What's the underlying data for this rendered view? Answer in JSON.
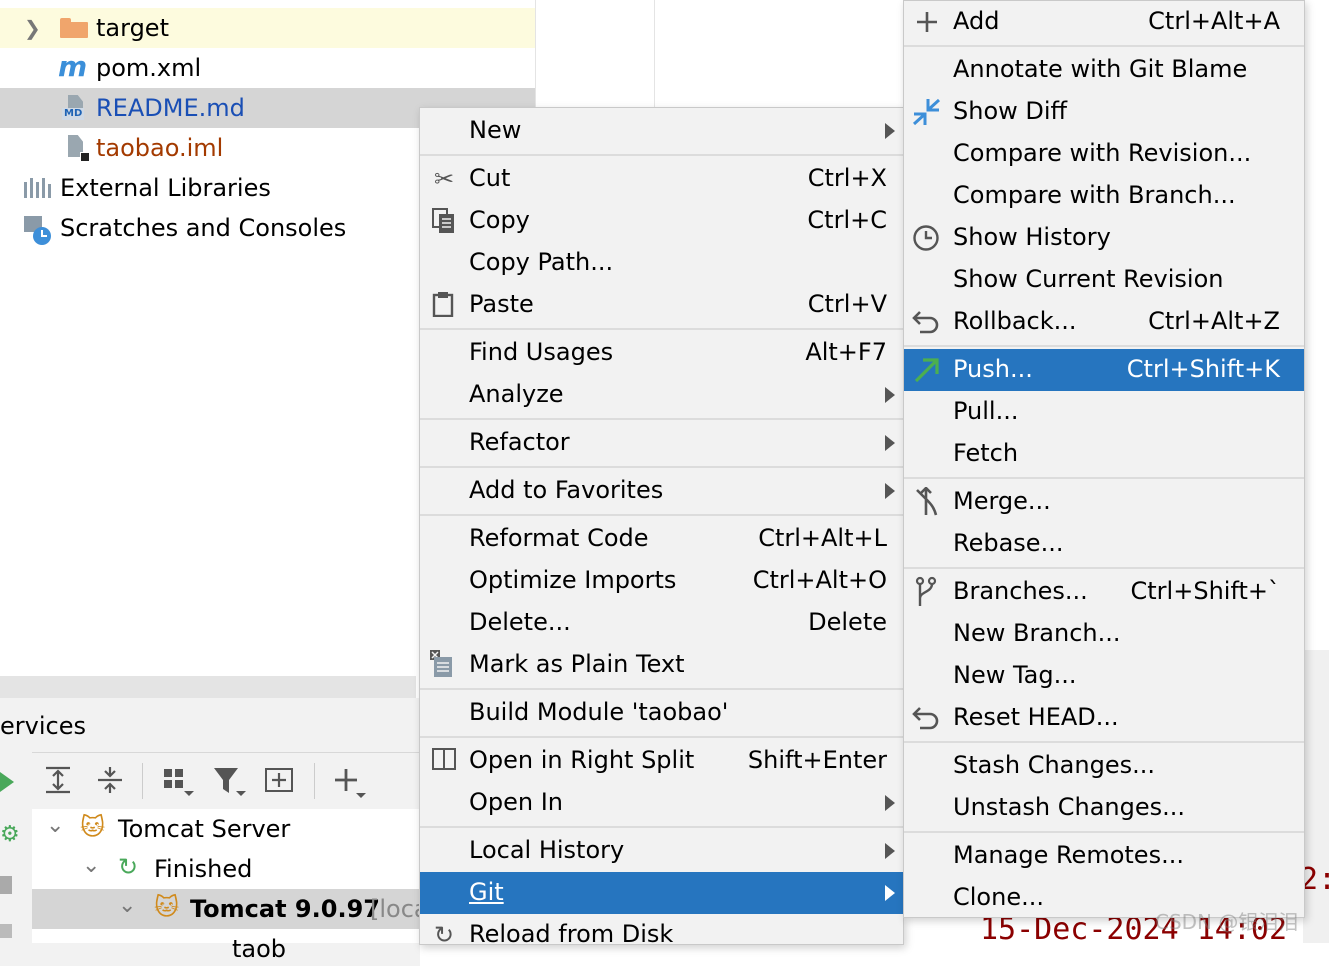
{
  "project_tree": {
    "items": [
      {
        "label": "target",
        "icon": "folder-icon",
        "color": "#000000"
      },
      {
        "label": "pom.xml",
        "icon": "maven-icon",
        "color": "#000000"
      },
      {
        "label": "README.md",
        "icon": "markdown-file-icon",
        "icon_tag": "MD",
        "color": "#1a4fb5"
      },
      {
        "label": "taobao.iml",
        "icon": "module-file-icon",
        "color": "#a33a00"
      },
      {
        "label": "External Libraries",
        "icon": "library-icon",
        "color": "#000000"
      },
      {
        "label": "Scratches and Consoles",
        "icon": "scratches-icon",
        "color": "#000000"
      }
    ]
  },
  "services": {
    "title": "ervices",
    "tree": [
      {
        "label": "Tomcat Server"
      },
      {
        "label": "Finished"
      },
      {
        "label": "Tomcat 9.0.97",
        "suffix": "[loca"
      },
      {
        "label": "taob"
      }
    ]
  },
  "context_menu": {
    "items": [
      {
        "label": "New",
        "shortcut": "",
        "submenu": true
      },
      {
        "label": "Cut",
        "shortcut": "Ctrl+X",
        "icon": "scissors-icon"
      },
      {
        "label": "Copy",
        "shortcut": "Ctrl+C",
        "icon": "copy-icon"
      },
      {
        "label": "Copy Path...",
        "shortcut": ""
      },
      {
        "label": "Paste",
        "shortcut": "Ctrl+V",
        "icon": "clipboard-icon"
      },
      {
        "label": "Find Usages",
        "shortcut": "Alt+F7"
      },
      {
        "label": "Analyze",
        "shortcut": "",
        "submenu": true
      },
      {
        "label": "Refactor",
        "shortcut": "",
        "submenu": true
      },
      {
        "label": "Add to Favorites",
        "shortcut": "",
        "submenu": true
      },
      {
        "label": "Reformat Code",
        "shortcut": "Ctrl+Alt+L"
      },
      {
        "label": "Optimize Imports",
        "shortcut": "Ctrl+Alt+O"
      },
      {
        "label": "Delete...",
        "shortcut": "Delete"
      },
      {
        "label": "Mark as Plain Text",
        "shortcut": "",
        "icon": "plain-text-icon"
      },
      {
        "label": "Build Module 'taobao'",
        "shortcut": ""
      },
      {
        "label": "Open in Right Split",
        "shortcut": "Shift+Enter",
        "icon": "split-icon"
      },
      {
        "label": "Open In",
        "shortcut": "",
        "submenu": true
      },
      {
        "label": "Local History",
        "shortcut": "",
        "submenu": true
      },
      {
        "label": "Git",
        "shortcut": "",
        "submenu": true,
        "selected": true
      },
      {
        "label": "Reload from Disk",
        "shortcut": "",
        "icon": "reload-icon"
      }
    ]
  },
  "git_menu": {
    "items": [
      {
        "label": "Add",
        "shortcut": "Ctrl+Alt+A",
        "icon": "plus-icon"
      },
      {
        "label": "Annotate with Git Blame",
        "shortcut": ""
      },
      {
        "label": "Show Diff",
        "shortcut": "",
        "icon": "diff-icon"
      },
      {
        "label": "Compare with Revision...",
        "shortcut": ""
      },
      {
        "label": "Compare with Branch...",
        "shortcut": ""
      },
      {
        "label": "Show History",
        "shortcut": "",
        "icon": "clock-icon"
      },
      {
        "label": "Show Current Revision",
        "shortcut": ""
      },
      {
        "label": "Rollback...",
        "shortcut": "Ctrl+Alt+Z",
        "icon": "rollback-icon"
      },
      {
        "label": "Push...",
        "shortcut": "Ctrl+Shift+K",
        "icon": "push-arrow-icon",
        "selected": true
      },
      {
        "label": "Pull...",
        "shortcut": ""
      },
      {
        "label": "Fetch",
        "shortcut": ""
      },
      {
        "label": "Merge...",
        "shortcut": "",
        "icon": "merge-icon"
      },
      {
        "label": "Rebase...",
        "shortcut": ""
      },
      {
        "label": "Branches...",
        "shortcut": "Ctrl+Shift+`",
        "icon": "branch-icon"
      },
      {
        "label": "New Branch...",
        "shortcut": ""
      },
      {
        "label": "New Tag...",
        "shortcut": ""
      },
      {
        "label": "Reset HEAD...",
        "shortcut": "",
        "icon": "reset-icon"
      },
      {
        "label": "Stash Changes...",
        "shortcut": ""
      },
      {
        "label": "Unstash Changes...",
        "shortcut": ""
      },
      {
        "label": "Manage Remotes...",
        "shortcut": ""
      },
      {
        "label": "Clone...",
        "shortcut": ""
      }
    ]
  },
  "editor": {
    "code_line": "15-Dec-2024 14:02",
    "code_right": "2:"
  },
  "watermark": "CSDN @银泪泪",
  "colors": {
    "selection": "#2675bf",
    "menu_bg": "#f2f2f2",
    "tree_selected": "#d5d5d5",
    "tree_highlight": "#fdfbde",
    "push_icon": "#4caf50"
  }
}
